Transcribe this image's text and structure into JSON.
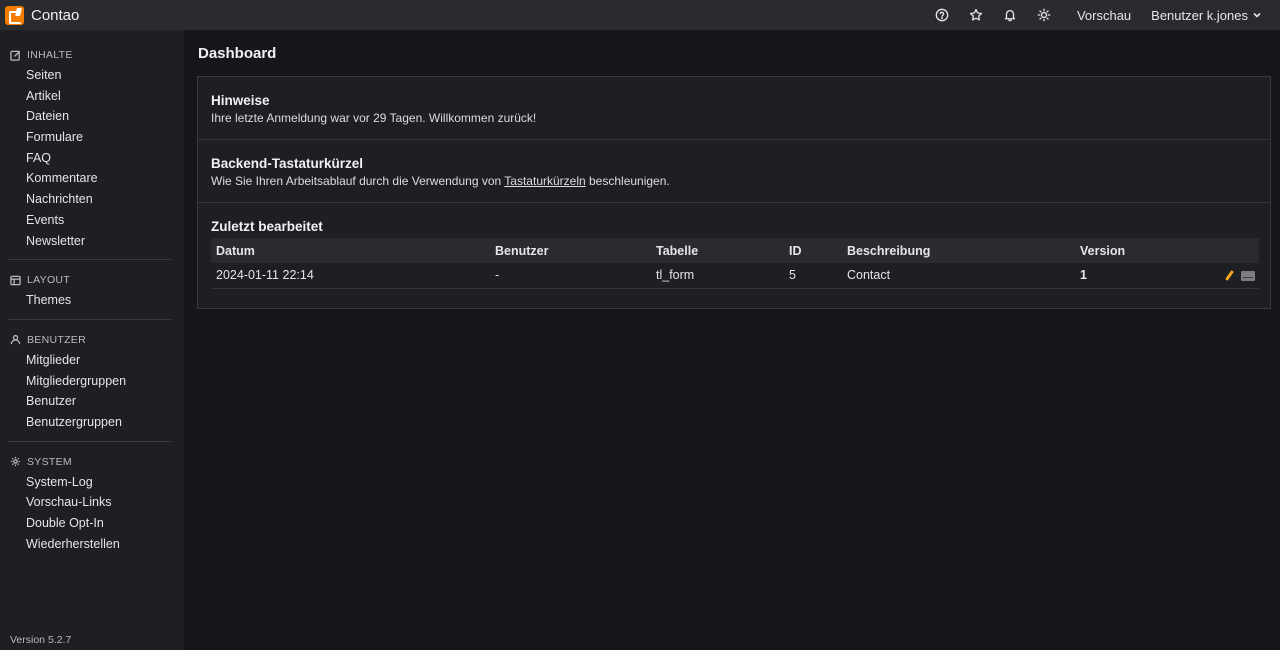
{
  "app": {
    "title": "Contao"
  },
  "topbar": {
    "icons": [
      "help-icon",
      "star-icon",
      "bell-icon",
      "sun-icon"
    ],
    "preview_label": "Vorschau",
    "user_label": "Benutzer k.jones"
  },
  "sidebar": {
    "groups": [
      {
        "heading": "INHALTE",
        "icon": "edit-icon",
        "items": [
          "Seiten",
          "Artikel",
          "Dateien",
          "Formulare",
          "FAQ",
          "Kommentare",
          "Nachrichten",
          "Events",
          "Newsletter"
        ]
      },
      {
        "heading": "LAYOUT",
        "icon": "layout-icon",
        "items": [
          "Themes"
        ]
      },
      {
        "heading": "BENUTZER",
        "icon": "user-icon",
        "items": [
          "Mitglieder",
          "Mitgliedergruppen",
          "Benutzer",
          "Benutzergruppen"
        ]
      },
      {
        "heading": "SYSTEM",
        "icon": "gear-icon",
        "items": [
          "System-Log",
          "Vorschau-Links",
          "Double Opt-In",
          "Wiederherstellen"
        ]
      }
    ],
    "version": "Version 5.2.7"
  },
  "main": {
    "title": "Dashboard",
    "hints": {
      "title": "Hinweise",
      "text": "Ihre letzte Anmeldung war vor 29 Tagen. Willkommen zurück!"
    },
    "shortcuts": {
      "title": "Backend-Tastaturkürzel",
      "text_before": "Wie Sie Ihren Arbeitsablauf durch die Verwendung von ",
      "link": "Tastaturkürzeln",
      "text_after": " beschleunigen."
    },
    "recent": {
      "title": "Zuletzt bearbeitet",
      "columns": [
        "Datum",
        "Benutzer",
        "Tabelle",
        "ID",
        "Beschreibung",
        "Version"
      ],
      "rows": [
        {
          "datum": "2024-01-11 22:14",
          "benutzer": "-",
          "tabelle": "tl_form",
          "id": "5",
          "beschreibung": "Contact",
          "version": "1"
        }
      ]
    }
  }
}
